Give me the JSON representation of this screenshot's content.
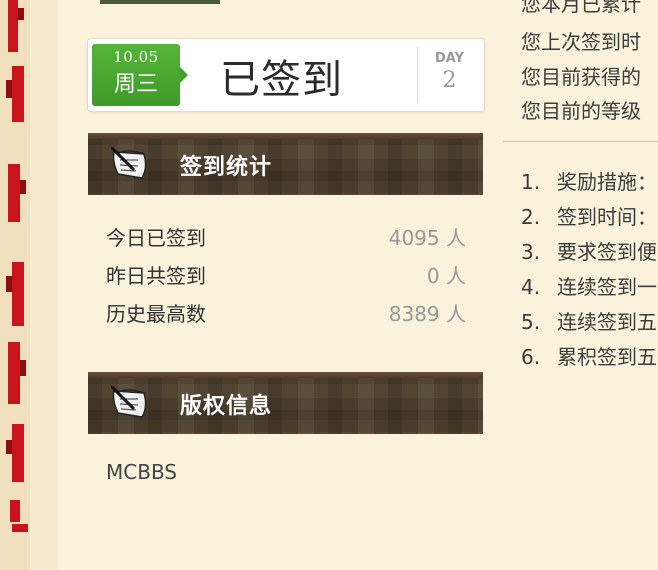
{
  "checkin": {
    "date": "10.05",
    "weekday": "周三",
    "status": "已签到",
    "day_label": "DAY",
    "day_count": "2"
  },
  "stats_section": {
    "title": "签到统计",
    "rows": [
      {
        "label": "今日已签到",
        "value": "4095 人"
      },
      {
        "label": "昨日共签到",
        "value": "0 人"
      },
      {
        "label": "历史最高数",
        "value": "8389 人"
      }
    ]
  },
  "copyright_section": {
    "title": "版权信息",
    "text": "MCBBS"
  },
  "right_info": {
    "lines": [
      "您本月已累计",
      "您上次签到时",
      "您目前获得的",
      "您目前的等级"
    ]
  },
  "rules": [
    {
      "num": "1.",
      "text": "奖励措施："
    },
    {
      "num": "2.",
      "text": "签到时间："
    },
    {
      "num": "3.",
      "text": "要求签到便"
    },
    {
      "num": "4.",
      "text": "连续签到一"
    },
    {
      "num": "5.",
      "text": "连续签到五"
    },
    {
      "num": "6.",
      "text": "累积签到五"
    }
  ],
  "colors": {
    "background": "#fbf2dc",
    "badge_green": "#46a12e",
    "header_brown": "#4a3c2b",
    "decor_red": "#c8141a"
  },
  "icons": [
    "scroll-quill-icon"
  ]
}
